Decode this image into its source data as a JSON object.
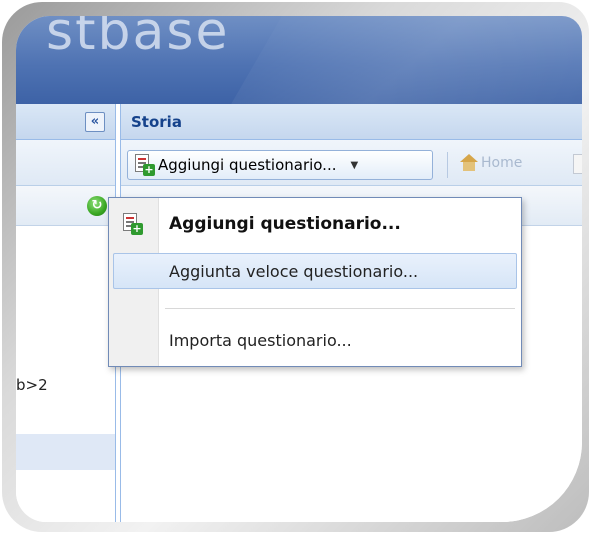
{
  "app": {
    "logo_text": "stbase"
  },
  "left_panel": {
    "collapse_label": "«",
    "refresh_label": "↻",
    "row_text": "b>2"
  },
  "right_panel": {
    "title": "Storia",
    "toolbar": {
      "add_button_label": "Aggiungi questionario...",
      "add_button_arrow": "▼",
      "home_label": "Home"
    }
  },
  "dropdown_menu": {
    "items": [
      {
        "label": "Aggiungi questionario...",
        "icon": "add-document-icon"
      },
      {
        "label": "Aggiunta veloce questionario...",
        "icon": ""
      },
      {
        "label": "Importa questionario...",
        "icon": ""
      }
    ]
  },
  "colors": {
    "header_blue": "#4f73b3",
    "panel_title": "#15428b",
    "panel_border": "#99bbe8",
    "menu_highlight": "#d6e5f7"
  }
}
